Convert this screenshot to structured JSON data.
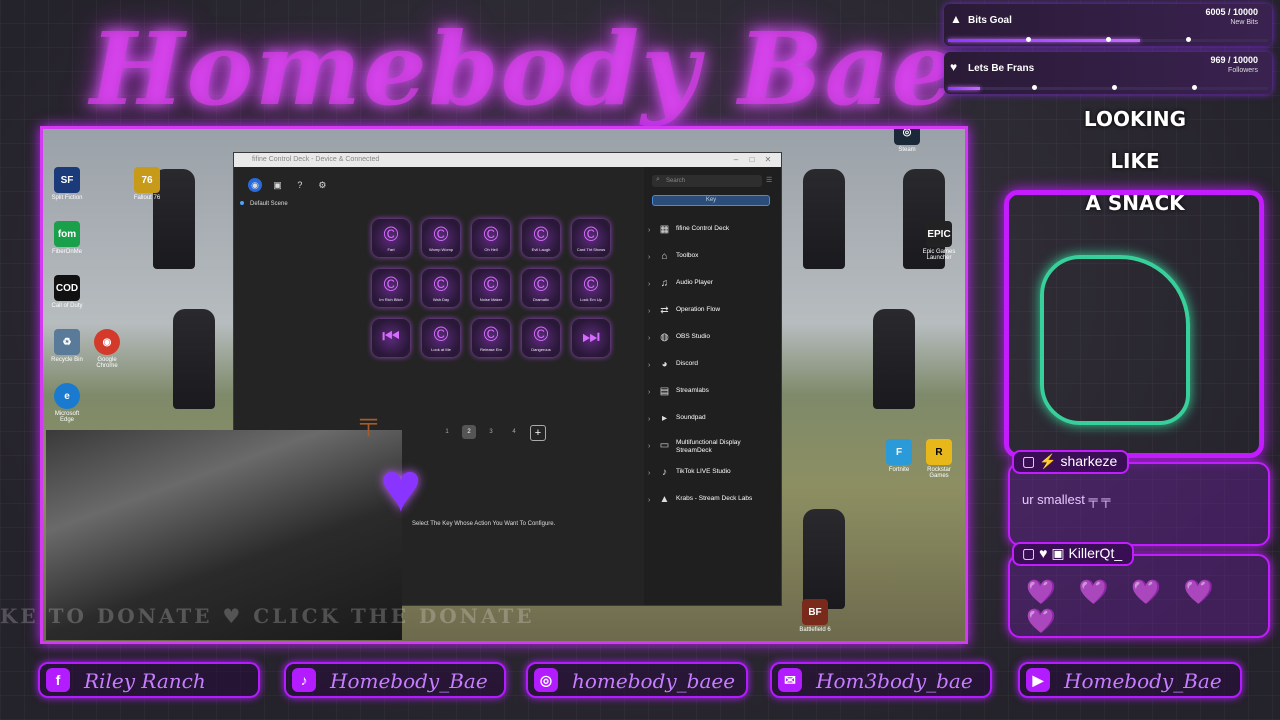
{
  "overlay_title": "Homebody Bae",
  "goals": [
    {
      "label": "Bits Goal",
      "value": "6005 / 10000",
      "sub": "New Bits",
      "progress": 0.6
    },
    {
      "label": "Lets Be Frans",
      "value": "969 / 10000",
      "sub": "Followers",
      "progress": 0.1
    }
  ],
  "tagline": [
    "LOOKING LIKE",
    "A SNACK"
  ],
  "desktop_icons": [
    "Split Fiction",
    "Fallout 76",
    "FiberOnMe",
    "Call of Duty",
    "Recycle Bin",
    "Google Chrome",
    "Microsoft Edge",
    "Steam",
    "Epic Games Launcher",
    "Rockstar Games",
    "Fortnite",
    "Battlefield 6"
  ],
  "app_window": {
    "title": "fifine Control Deck - Device & Connected",
    "scene": "Default Scene",
    "keys": [
      {
        "label": "Fart"
      },
      {
        "label": "Womp Womp"
      },
      {
        "label": "Oh Hell"
      },
      {
        "label": "Evil Laugh"
      },
      {
        "label": "Card Tht Shows"
      },
      {
        "label": "Im Rich Bitch"
      },
      {
        "label": "Wah Day"
      },
      {
        "label": "Noise Maker"
      },
      {
        "label": "Dramatic"
      },
      {
        "label": "Lock Em Up"
      },
      {
        "label": ""
      },
      {
        "label": "Look at Me"
      },
      {
        "label": "Release Em"
      },
      {
        "label": "Dangerous"
      },
      {
        "label": ""
      }
    ],
    "pages": [
      "1",
      "2",
      "3",
      "4",
      "+"
    ],
    "hint": "Select The Key Whose Action You Want To Configure.",
    "search_placeholder": "Search",
    "key_tab": "Key",
    "plugins": [
      "fifine Control Deck",
      "Toolbox",
      "Audio Player",
      "Operation Flow",
      "OBS Studio",
      "Discord",
      "Streamlabs",
      "Soundpad",
      "Multifunctional Display StreamDeck",
      "TikTok LIVE Studio",
      "Krabs - Stream Deck Labs"
    ]
  },
  "marquee": "KE TO DONATE ♥ CLICK THE DONATE",
  "chat": [
    {
      "user": "sharkeze",
      "message": "ur smallest"
    },
    {
      "user": "KillerQt_",
      "message": "💜 💜 💜 💜 💜"
    }
  ],
  "socials": [
    {
      "icon": "f",
      "handle": "Riley Ranch"
    },
    {
      "icon": "♪",
      "handle": "Homebody_Bae"
    },
    {
      "icon": "◎",
      "handle": "homebody_baee"
    },
    {
      "icon": "✉",
      "handle": "Hom3body_bae"
    },
    {
      "icon": "▶",
      "handle": "Homebody_Bae"
    }
  ]
}
